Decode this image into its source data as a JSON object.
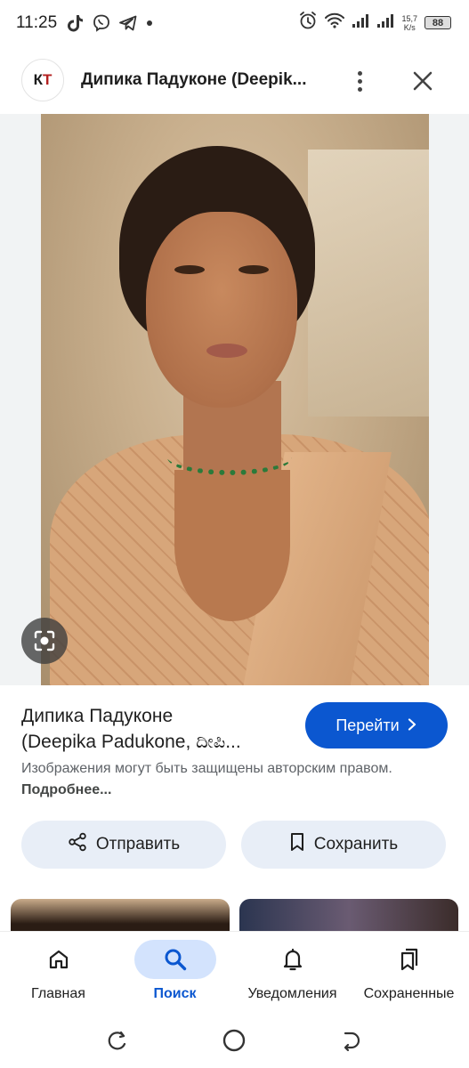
{
  "status_bar": {
    "time": "11:25",
    "net_speed_value": "15,7",
    "net_speed_unit": "K/s",
    "battery": "88"
  },
  "app_bar": {
    "site_logo_text_1": "К",
    "site_logo_text_2": "Т",
    "title": "Дипика Падуконе (Deepik..."
  },
  "result": {
    "title_line1": "Дипика Падуконе",
    "title_line2": "(Deepika Padukone, ದೀಪಿ...",
    "visit_label": "Перейти",
    "notice_text": "Изображения могут быть защищены авторским правом.",
    "notice_link": "Подробнее..."
  },
  "actions": {
    "share_label": "Отправить",
    "save_label": "Сохранить"
  },
  "bottom_nav": {
    "items": [
      {
        "label": "Главная",
        "icon": "home-icon",
        "active": false
      },
      {
        "label": "Поиск",
        "icon": "search-icon",
        "active": true
      },
      {
        "label": "Уведомления",
        "icon": "bell-icon",
        "active": false
      },
      {
        "label": "Сохраненные",
        "icon": "bookmarks-icon",
        "active": false
      }
    ]
  },
  "colors": {
    "accent": "#0b57d0",
    "pill_bg": "#e8eef7",
    "active_nav_bg": "#d3e3fd"
  }
}
